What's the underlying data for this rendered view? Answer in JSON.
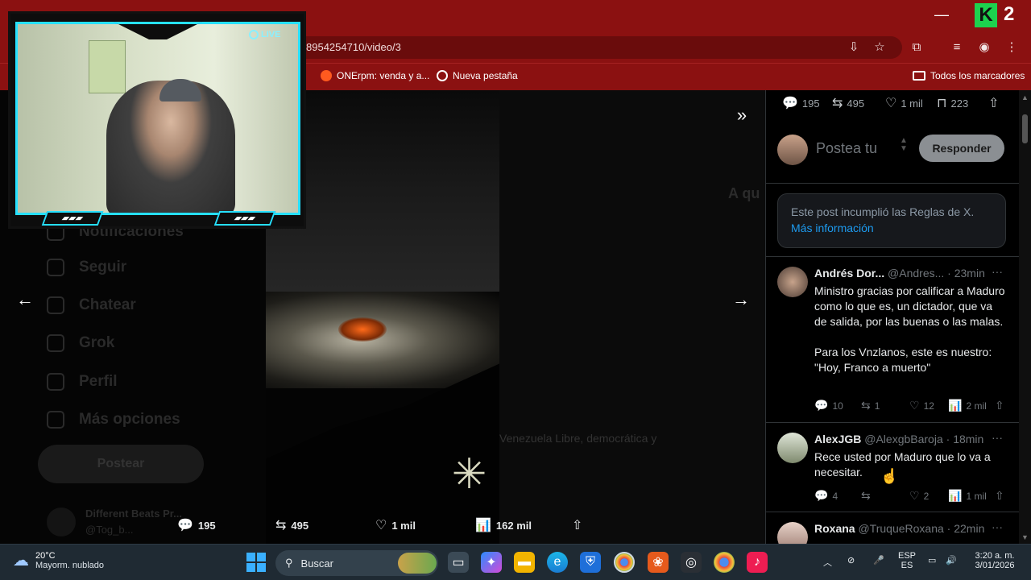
{
  "browser": {
    "url": "8954254710/video/3",
    "window_controls": {
      "minimize": "—"
    },
    "overlay_brand": {
      "logo": "K",
      "number": "2"
    },
    "bookmarks": [
      {
        "label": "ONErpm: venda y a..."
      },
      {
        "label": "Nueva pestaña"
      }
    ],
    "all_bookmarks_label": "Todos los marcadores"
  },
  "webcam": {
    "live_label": "LIVE"
  },
  "sidenav": {
    "items": [
      {
        "label": "Notificaciones"
      },
      {
        "label": "Seguir"
      },
      {
        "label": "Chatear"
      },
      {
        "label": "Grok"
      },
      {
        "label": "Perfil"
      },
      {
        "label": "Más opciones"
      }
    ],
    "post_button": "Postear",
    "account": {
      "name": "Different Beats Pr...",
      "handle": "@Tog_b..."
    }
  },
  "video": {
    "background_texts": [
      "A qu",
      "Venezuela Libre, democrática y"
    ],
    "stats": {
      "replies": "195",
      "reposts": "495",
      "likes": "1 mil",
      "views": "162 mil"
    }
  },
  "panel": {
    "top_actions": {
      "replies": "195",
      "reposts": "495",
      "likes": "1 mil",
      "bookmarks": "223"
    },
    "compose": {
      "placeholder": "Postea tu",
      "reply_button": "Responder"
    },
    "notice": {
      "text": "Este post incumplió las Reglas de X.",
      "link": "Más información"
    },
    "replies": [
      {
        "name": "Andrés Dor...",
        "handle": "@Andres...",
        "time": "· 23min",
        "text": "Ministro gracias por calificar a Maduro como lo que es, un dictador, que va de salida, por las buenas o las malas.\n\nPara los Vnzlanos, este es nuestro: \"Hoy, Franco a muerto\"",
        "replies": "10",
        "reposts": "1",
        "likes": "12",
        "views": "2 mil"
      },
      {
        "name": "AlexJGB",
        "handle": "@AlexgbBaroja",
        "time": "· 18min",
        "text": "Rece usted por Maduro que lo va a necesitar.",
        "replies": "4",
        "reposts": "",
        "likes": "2",
        "views": "1 mil"
      },
      {
        "name": "Roxana",
        "handle": "@TruqueRoxana",
        "time": "· 22min",
        "text": "",
        "replies": "",
        "reposts": "",
        "likes": "",
        "views": ""
      }
    ]
  },
  "taskbar": {
    "weather": {
      "temp": "20°C",
      "desc": "Mayorm. nublado"
    },
    "search_label": "Buscar",
    "language": {
      "line1": "ESP",
      "line2": "ES"
    },
    "clock": {
      "time": "3:20 a. m.",
      "date": "3/01/2026"
    }
  }
}
